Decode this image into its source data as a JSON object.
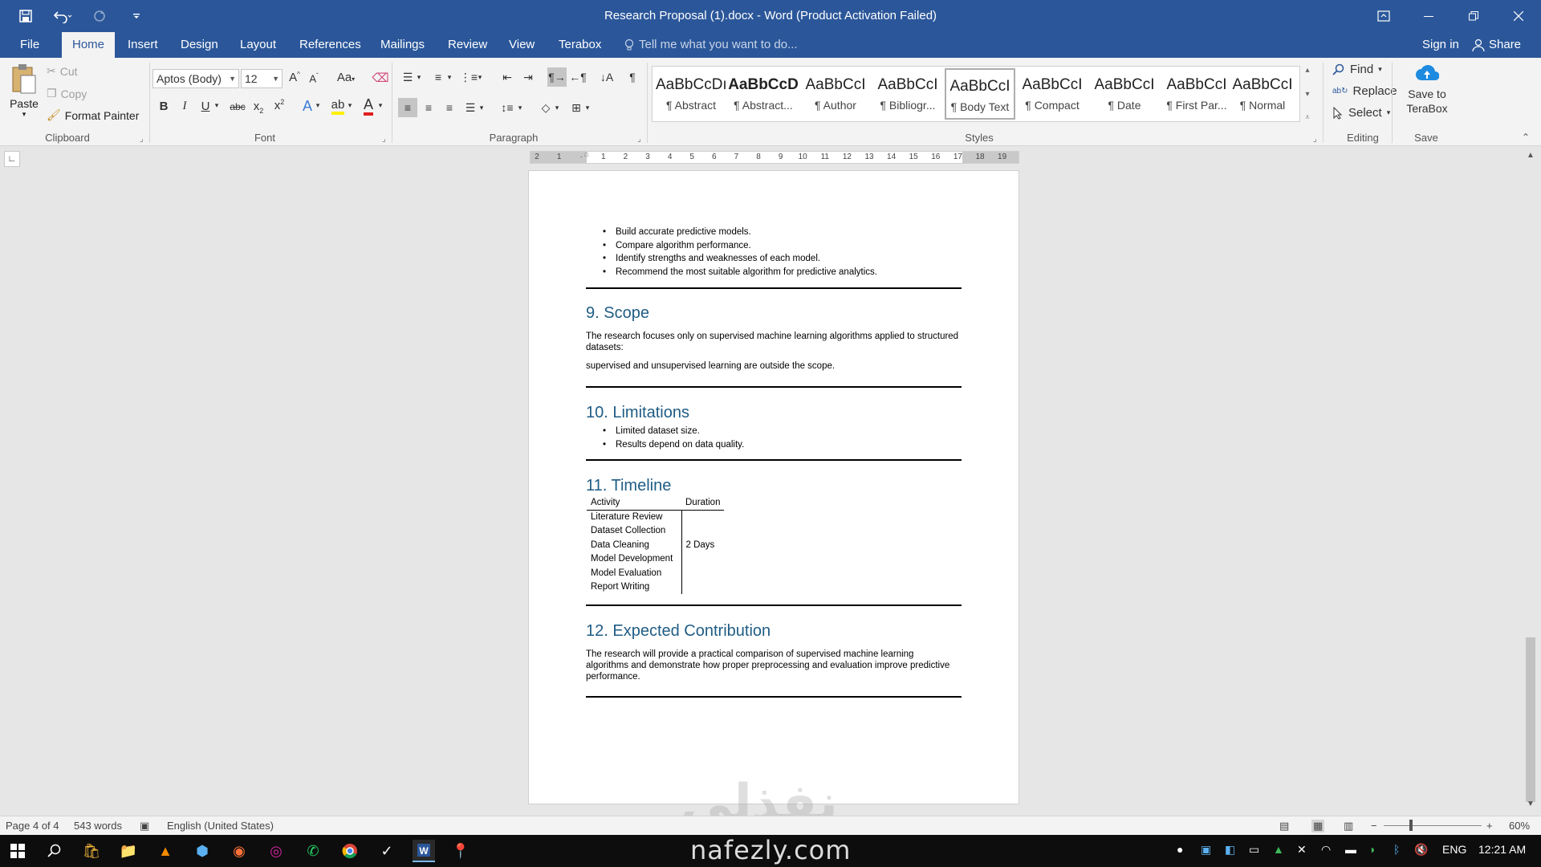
{
  "titlebar": {
    "title": "Research Proposal (1).docx - Word (Product Activation Failed)"
  },
  "tabs": {
    "file": "File",
    "home": "Home",
    "insert": "Insert",
    "design": "Design",
    "layout": "Layout",
    "references": "References",
    "mailings": "Mailings",
    "review": "Review",
    "view": "View",
    "terabox": "Terabox",
    "tell_me": "Tell me what you want to do...",
    "sign_in": "Sign in",
    "share": "Share"
  },
  "ribbon": {
    "clipboard": {
      "label": "Clipboard",
      "paste": "Paste",
      "cut": "Cut",
      "copy": "Copy",
      "format_painter": "Format Painter"
    },
    "font": {
      "label": "Font",
      "font_name": "Aptos (Body)",
      "font_size": "12"
    },
    "paragraph": {
      "label": "Paragraph"
    },
    "styles": {
      "label": "Styles",
      "items": [
        {
          "preview": "AaBbCcDı",
          "name": "¶ Abstract"
        },
        {
          "preview": "AaBbCcD",
          "name": "¶ Abstract..."
        },
        {
          "preview": "AaBbCcI",
          "name": "¶ Author"
        },
        {
          "preview": "AaBbCcI",
          "name": "¶ Bibliogr..."
        },
        {
          "preview": "AaBbCcI",
          "name": "¶ Body Text"
        },
        {
          "preview": "AaBbCcI",
          "name": "¶ Compact"
        },
        {
          "preview": "AaBbCcI",
          "name": "¶ Date"
        },
        {
          "preview": "AaBbCcI",
          "name": "¶ First Par..."
        },
        {
          "preview": "AaBbCcI",
          "name": "¶ Normal"
        }
      ]
    },
    "editing": {
      "label": "Editing",
      "find": "Find",
      "replace": "Replace",
      "select": "Select"
    },
    "save": {
      "label": "Save",
      "save_to": "Save to",
      "terabox": "TeraBox"
    }
  },
  "ruler": {
    "ticks": [
      "2",
      "1",
      "",
      "1",
      "2",
      "3",
      "4",
      "5",
      "6",
      "7",
      "8",
      "9",
      "10",
      "11",
      "12",
      "13",
      "14",
      "15",
      "16",
      "17",
      "18",
      "19"
    ]
  },
  "document": {
    "objectives_bullets": [
      "Build accurate predictive models.",
      "Compare algorithm performance.",
      "Identify strengths and weaknesses of each model.",
      "Recommend the most suitable algorithm for predictive analytics."
    ],
    "scope": {
      "heading": "9. Scope",
      "p1": "The research focuses only on supervised machine learning algorithms applied to structured datasets:",
      "p2": "supervised and unsupervised learning are outside the scope."
    },
    "limitations": {
      "heading": "10. Limitations",
      "bullets": [
        "Limited dataset size.",
        "Results depend on data quality."
      ]
    },
    "timeline": {
      "heading": "11. Timeline",
      "headers": [
        "Activity",
        "Duration"
      ],
      "rows": [
        [
          "Literature Review",
          ""
        ],
        [
          "Dataset Collection",
          ""
        ],
        [
          "Data Cleaning",
          "2 Days"
        ],
        [
          "Model Development",
          ""
        ],
        [
          "Model Evaluation",
          ""
        ],
        [
          "Report Writing",
          ""
        ]
      ]
    },
    "contribution": {
      "heading": "12. Expected Contribution",
      "p1": "The research will provide a practical comparison of supervised machine learning algorithms and demonstrate how proper preprocessing and evaluation improve predictive performance."
    }
  },
  "watermark": {
    "arabic": "نفذلي",
    "url": "nafezly.com"
  },
  "statusbar": {
    "page": "Page 4 of 4",
    "words": "543 words",
    "language": "English (United States)",
    "zoom": "60%"
  },
  "taskbar": {
    "lang": "ENG",
    "time": "12:21 AM"
  }
}
